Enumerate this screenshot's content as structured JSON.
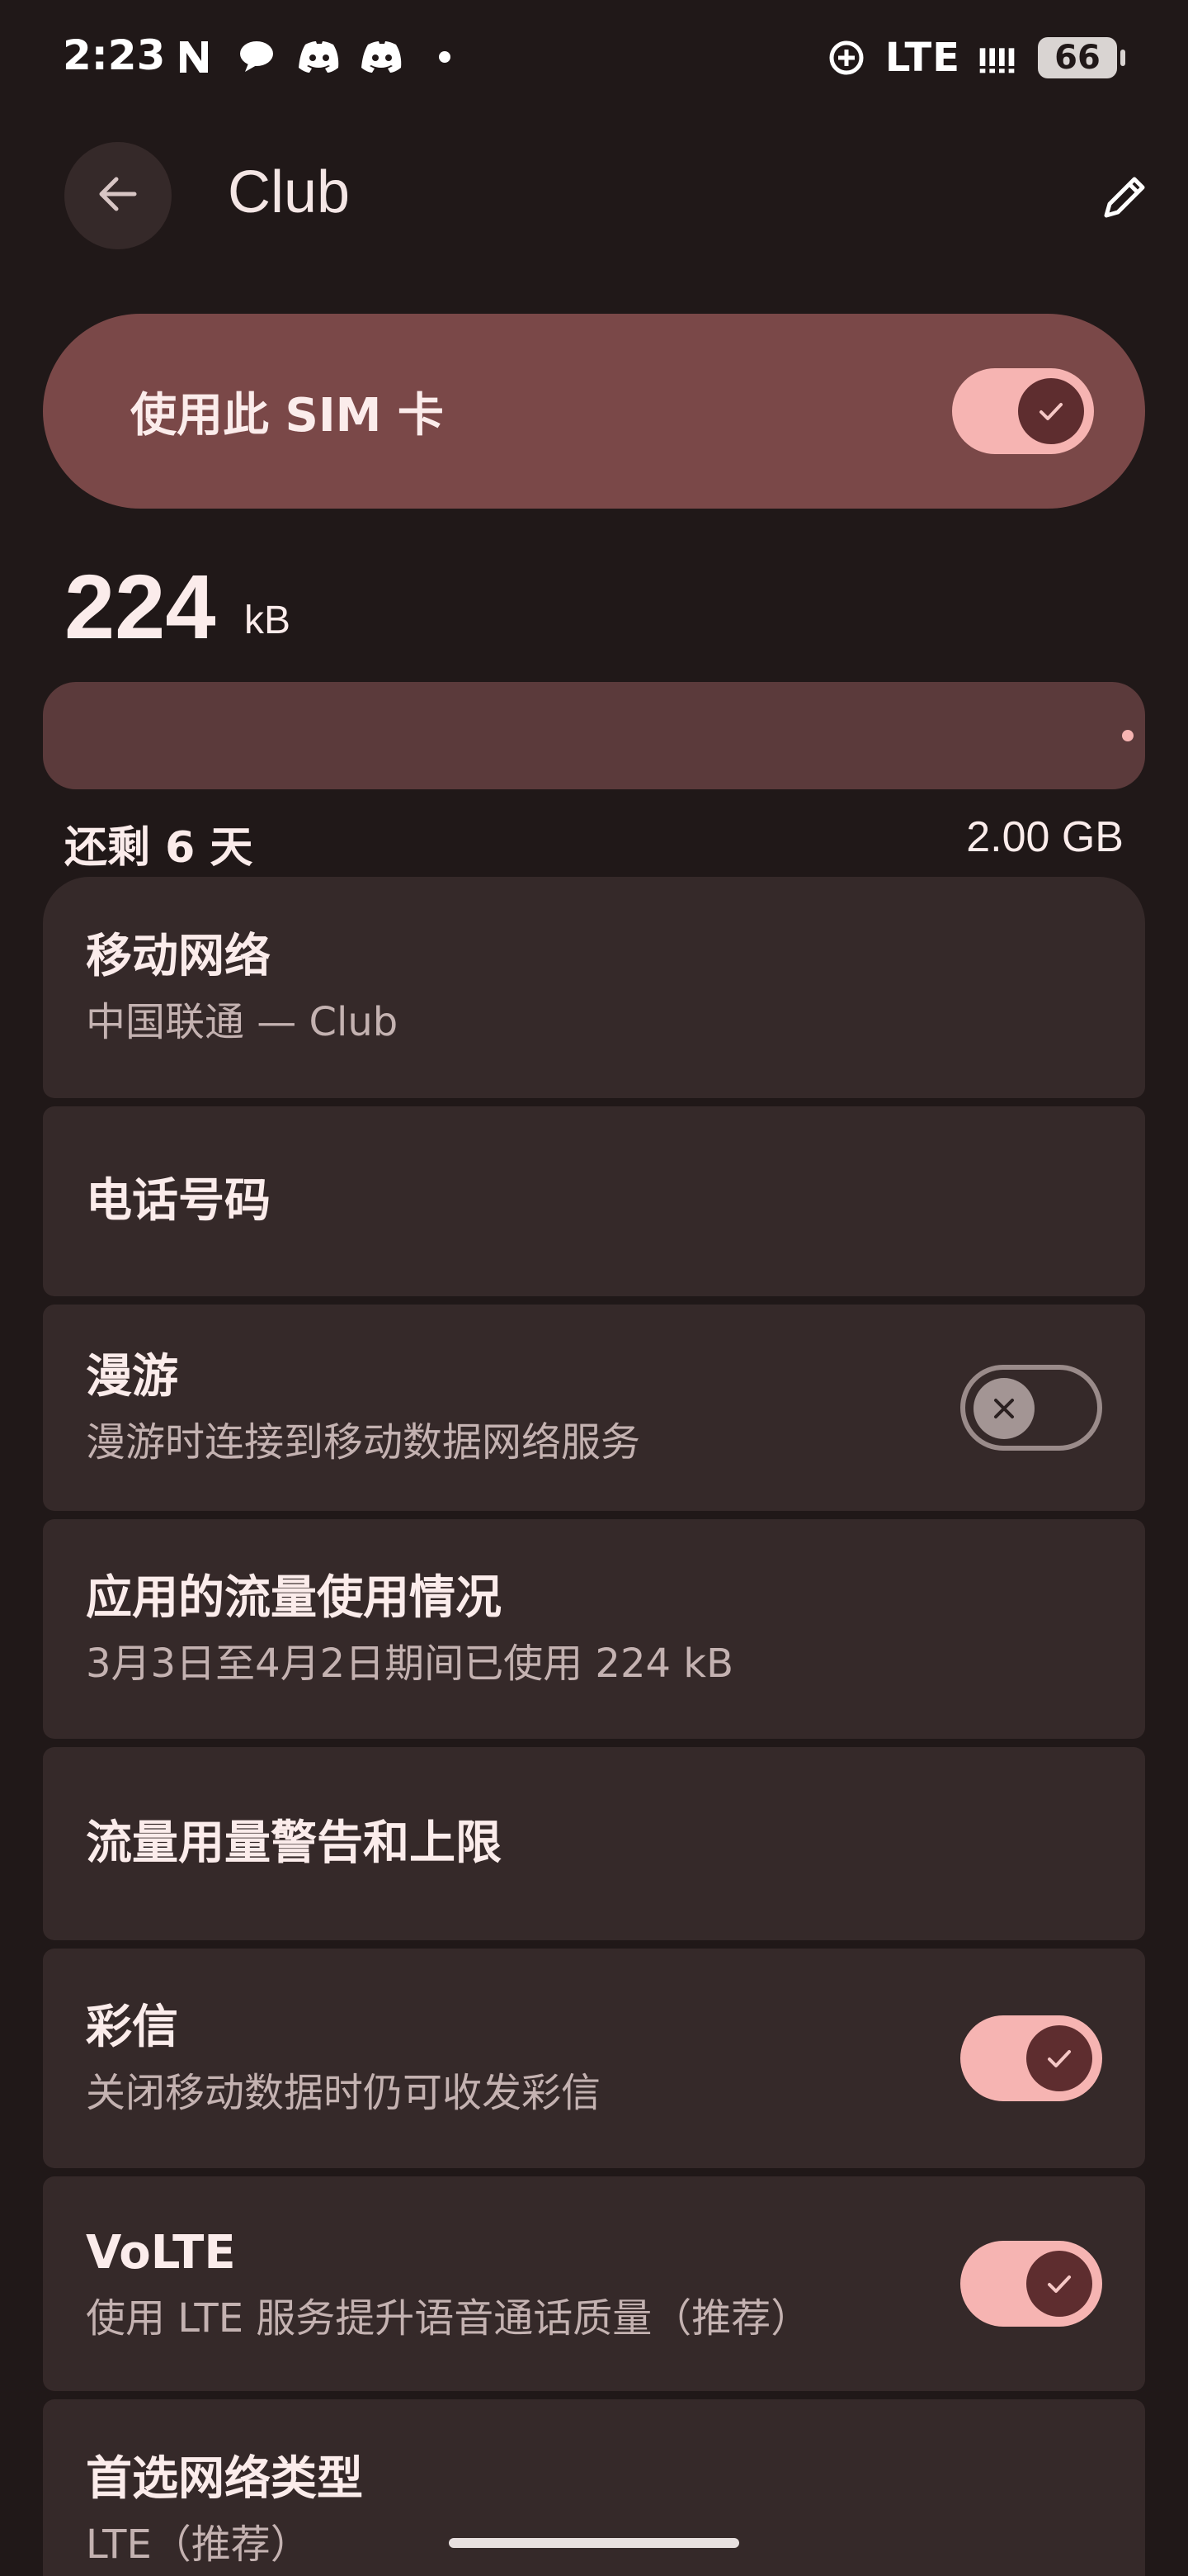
{
  "status_bar": {
    "time": "2:23",
    "left_icons": [
      "n-app-icon",
      "chat-bubble-icon",
      "discord-icon",
      "discord-icon",
      "dot-icon"
    ],
    "network": "LTE",
    "battery": "66"
  },
  "app_bar": {
    "title": "Club"
  },
  "sim_toggle": {
    "label": "使用此 SIM 卡",
    "enabled": true
  },
  "usage": {
    "value": "224",
    "unit": "kB",
    "progress_fraction": 0.0001,
    "days_left": "还剩 6 天",
    "limit": "2.00 GB"
  },
  "settings": [
    {
      "title": "移动网络",
      "subtitle": "中国联通 — Club"
    },
    {
      "title": "电话号码",
      "subtitle": ""
    },
    {
      "title": "漫游",
      "subtitle": "漫游时连接到移动数据网络服务",
      "toggle": false
    },
    {
      "title": "应用的流量使用情况",
      "subtitle": "3月3日至4月2日期间已使用 224 kB"
    },
    {
      "title": "流量用量警告和上限",
      "subtitle": ""
    },
    {
      "title": "彩信",
      "subtitle": "关闭移动数据时仍可收发彩信",
      "toggle": true
    },
    {
      "title": "VoLTE",
      "subtitle": "使用 LTE 服务提升语音通话质量（推荐）",
      "toggle": true
    },
    {
      "title": "首选网络类型",
      "subtitle": "LTE（推荐）"
    }
  ],
  "colors": {
    "background": "#201818",
    "card": "#352929",
    "sim_banner": "#7a4848",
    "toggle_on_track": "#f6b4b2",
    "toggle_on_knob": "#5e2d2f"
  }
}
